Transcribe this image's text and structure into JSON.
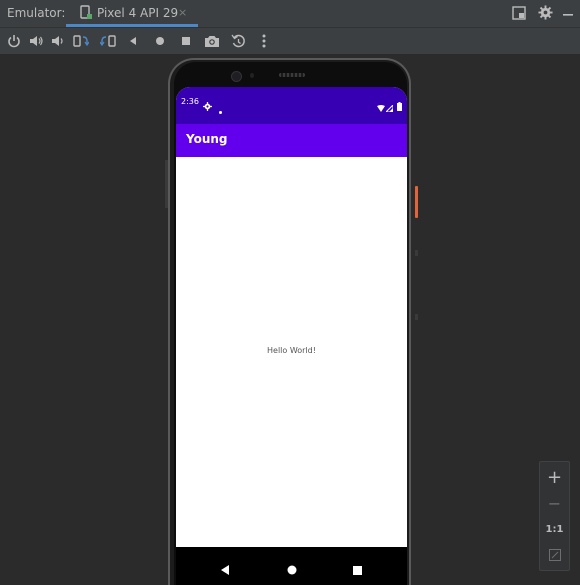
{
  "titlebar": {
    "emulator_label": "Emulator:",
    "tab_label": "Pixel 4 API 29",
    "tab_close": "×",
    "icons": [
      "restore-layout-icon",
      "gear-icon",
      "minimize-icon"
    ]
  },
  "toolbar": {
    "buttons": [
      "power-icon",
      "volume-up-icon",
      "volume-down-icon",
      "rotate-left-icon",
      "rotate-right-icon",
      "back-icon",
      "home-icon",
      "overview-icon",
      "screenshot-icon",
      "snapshot-icon",
      "more-icon"
    ]
  },
  "phone": {
    "status_time": "2:36",
    "app_title": "Young",
    "hello_text": "Hello World!",
    "colors": {
      "status_bar": "#3700b3",
      "app_bar": "#6200ee"
    }
  },
  "zoom": {
    "zoom_in": "+",
    "zoom_out": "−",
    "one_to_one": "1:1"
  },
  "colors": {
    "ide_bg": "#2b2b2b",
    "panel_bg": "#3c3f41",
    "tab_underline": "#4a88c7"
  }
}
